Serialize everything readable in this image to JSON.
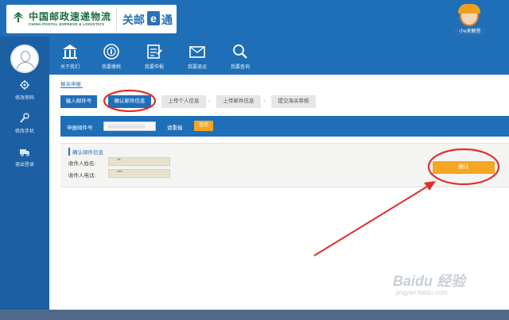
{
  "app": {
    "logo_cn": "中国邮政速递物流",
    "logo_en": "CHINA POSTAL EXPRESS & LOGISTICS",
    "brand_prefix": "关邮",
    "brand_e": "e",
    "brand_suffix": "通",
    "help_label": "小e来解答"
  },
  "sidebar": {
    "items": [
      {
        "label": "修改密码",
        "icon": "gear-icon"
      },
      {
        "label": "修改手机",
        "icon": "wrench-icon"
      },
      {
        "label": "退出登录",
        "icon": "truck-icon"
      }
    ]
  },
  "nav": {
    "items": [
      {
        "label": "关于我们",
        "icon": "building-icon"
      },
      {
        "label": "我要缴税",
        "icon": "coin-icon"
      },
      {
        "label": "我要申报",
        "icon": "form-icon"
      },
      {
        "label": "我要退运",
        "icon": "mail-icon"
      },
      {
        "label": "我要查询",
        "icon": "magnifier-icon"
      }
    ]
  },
  "main": {
    "breadcrumb": "报关申报",
    "steps": [
      {
        "label": "输入邮件号",
        "state": "active"
      },
      {
        "label": "确认邮件信息",
        "state": "active"
      },
      {
        "label": "上传个人信息",
        "state": "idle"
      },
      {
        "label": "上传邮件信息",
        "state": "idle"
      },
      {
        "label": "提交海关审核",
        "state": "idle"
      }
    ],
    "query": {
      "label": "申报邮件号",
      "input_value": "",
      "hint": "请重输",
      "button": "查询"
    },
    "info": {
      "title": "确认邮件信息",
      "recipient_name_label": "收件人姓名:",
      "recipient_name_value": "**",
      "recipient_phone_label": "收件人电话:",
      "recipient_phone_value": "***",
      "confirm_button": "确认"
    }
  },
  "watermark": {
    "text": "Baidu 经验",
    "url": "jingyan.baidu.com"
  },
  "colors": {
    "primary_blue": "#1f6fb8",
    "sidebar_blue": "#1c5fa3",
    "accent_orange": "#f5a623",
    "annotation_red": "#e0302a"
  }
}
